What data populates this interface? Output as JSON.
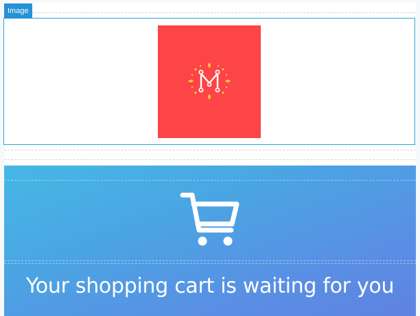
{
  "editor": {
    "image_block_tag": "Image"
  },
  "logo": {
    "icon": "m-logo-sunburst-icon",
    "letter": "M",
    "background_color": "#fd4447",
    "accent_color": "#fdc73b"
  },
  "hero": {
    "icon": "shopping-cart-icon",
    "title": "Your shopping cart is waiting for you",
    "gradient_start": "#46b8e4",
    "gradient_end": "#5f83e0"
  }
}
